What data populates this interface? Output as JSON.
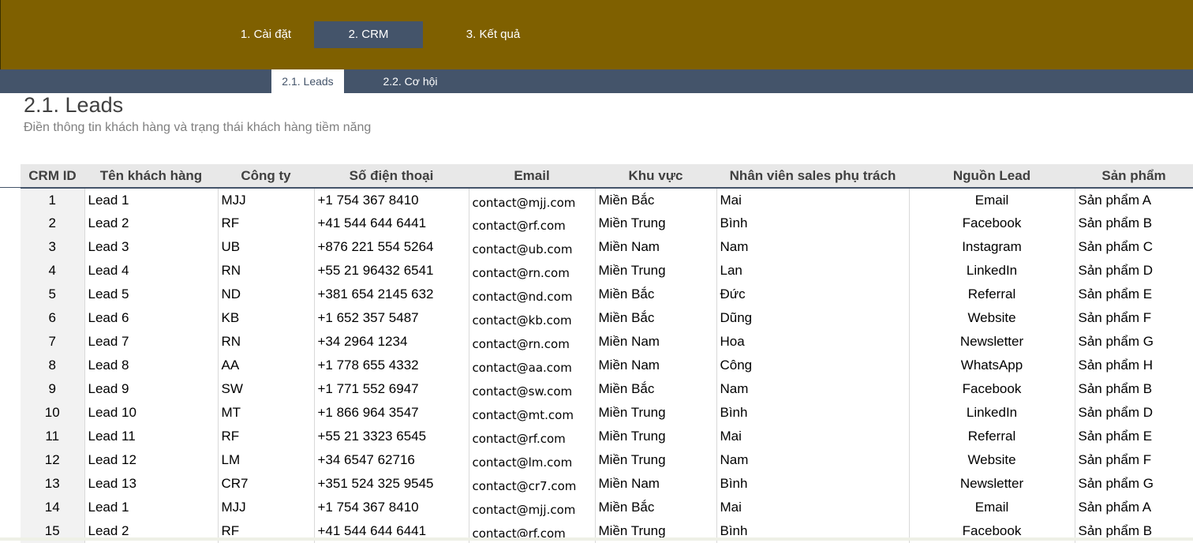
{
  "main_tabs": [
    "1. Cài đặt",
    "2. CRM",
    "3. Kết quả"
  ],
  "sub_tabs": [
    "2.1. Leads",
    "2.2. Cơ hội"
  ],
  "page": {
    "title": "2.1. Leads",
    "subtitle": "Điền thông tin khách hàng và trạng thái khách hàng tiềm năng"
  },
  "colors": {
    "topbar": "#7f6000",
    "active_tab": "#44546a",
    "subbar": "#44546a"
  },
  "table": {
    "headers": [
      "CRM ID",
      "Tên khách hàng",
      "Công ty",
      "Số điện thoại",
      "Email",
      "Khu vực",
      "Nhân viên sales phụ trách",
      "Nguồn Lead",
      "Sản phẩm"
    ],
    "rows": [
      [
        "1",
        "Lead 1",
        "MJJ",
        "+1 754 367 8410",
        "contact@mjj.com",
        "Miền Bắc",
        "Mai",
        "Email",
        "Sản phẩm A"
      ],
      [
        "2",
        "Lead 2",
        "RF",
        "+41 544 644 6441",
        "contact@rf.com",
        "Miền Trung",
        "Bình",
        "Facebook",
        "Sản phẩm B"
      ],
      [
        "3",
        "Lead 3",
        "UB",
        "+876 221 554 5264",
        "contact@ub.com",
        "Miền Nam",
        "Nam",
        "Instagram",
        "Sản phẩm C"
      ],
      [
        "4",
        "Lead 4",
        "RN",
        "+55 21 96432 6541",
        "contact@rn.com",
        "Miền Trung",
        "Lan",
        "LinkedIn",
        "Sản phẩm D"
      ],
      [
        "5",
        "Lead 5",
        "ND",
        "+381 654 2145 632",
        "contact@nd.com",
        "Miền Bắc",
        "Đức",
        "Referral",
        "Sản phẩm E"
      ],
      [
        "6",
        "Lead 6",
        "KB",
        "+1 652 357 5487",
        "contact@kb.com",
        "Miền Bắc",
        "Dũng",
        "Website",
        "Sản phẩm F"
      ],
      [
        "7",
        "Lead 7",
        "RN",
        "+34 2964 1234",
        "contact@rn.com",
        "Miền Nam",
        "Hoa",
        "Newsletter",
        "Sản phẩm G"
      ],
      [
        "8",
        "Lead 8",
        "AA",
        "+1 778 655 4332",
        "contact@aa.com",
        "Miền Nam",
        "Công",
        "WhatsApp",
        "Sản phẩm H"
      ],
      [
        "9",
        "Lead 9",
        "SW",
        "+1 771 552 6947",
        "contact@sw.com",
        "Miền Bắc",
        "Nam",
        "Facebook",
        "Sản phẩm B"
      ],
      [
        "10",
        "Lead 10",
        "MT",
        "+1 866 964 3547",
        "contact@mt.com",
        "Miền Trung",
        "Bình",
        "LinkedIn",
        "Sản phẩm D"
      ],
      [
        "11",
        "Lead 11",
        "RF",
        "+55 21 3323 6545",
        "contact@rf.com",
        "Miền Trung",
        "Mai",
        "Referral",
        "Sản phẩm E"
      ],
      [
        "12",
        "Lead 12",
        "LM",
        "+34 6547 62716",
        "contact@lm.com",
        "Miền Trung",
        "Nam",
        "Website",
        "Sản phẩm F"
      ],
      [
        "13",
        "Lead 13",
        "CR7",
        "+351 524 325 9545",
        "contact@cr7.com",
        "Miền Nam",
        "Bình",
        "Newsletter",
        "Sản phẩm G"
      ],
      [
        "14",
        "Lead 1",
        "MJJ",
        "+1 754 367 8410",
        "contact@mjj.com",
        "Miền Bắc",
        "Mai",
        "Email",
        "Sản phẩm A"
      ],
      [
        "15",
        "Lead 2",
        "RF",
        "+41 544 644 6441",
        "contact@rf.com",
        "Miền Trung",
        "Bình",
        "Facebook",
        "Sản phẩm B"
      ]
    ]
  }
}
